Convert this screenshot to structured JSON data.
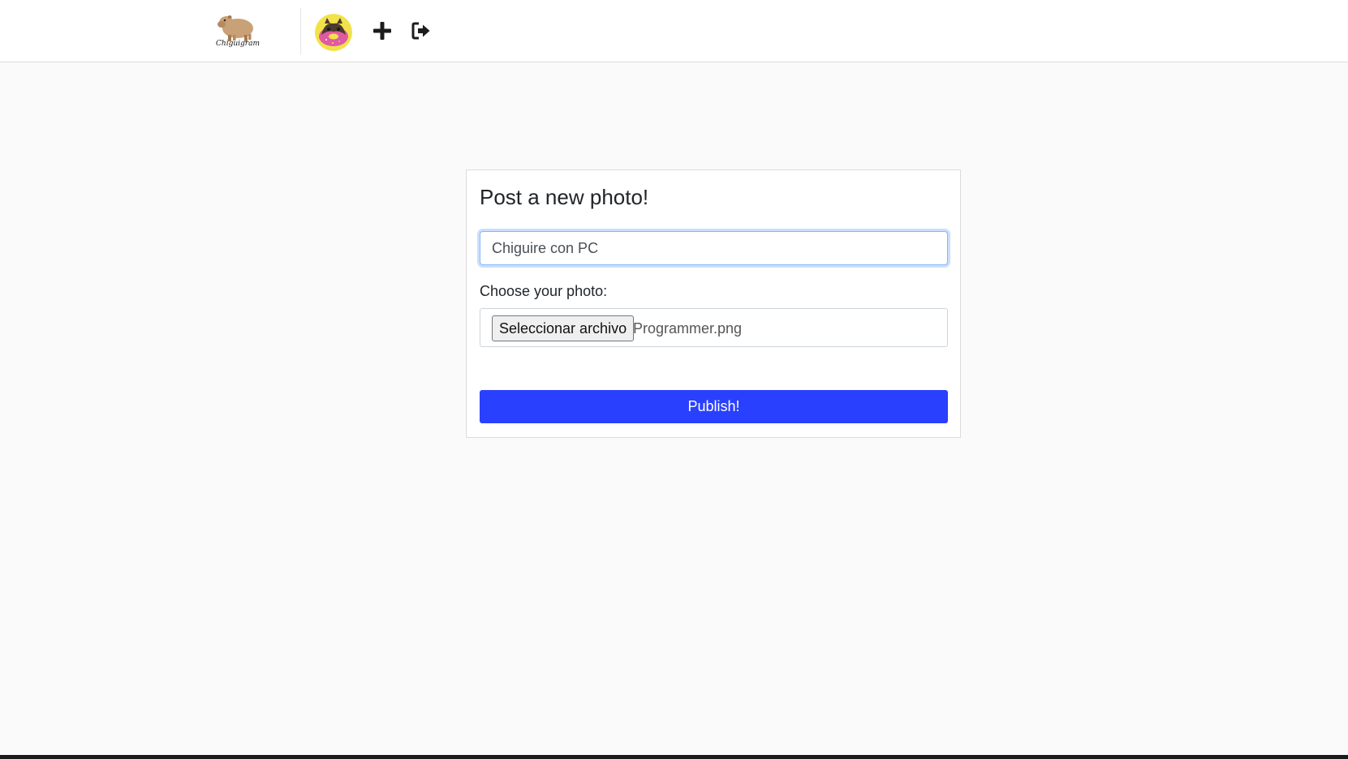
{
  "navbar": {
    "logo_text": "Chiguigram",
    "logo_icon": "capybara-logo",
    "avatar_icon": "user-avatar-donut",
    "plus_icon": "plus-icon",
    "logout_icon": "logout-icon"
  },
  "form": {
    "title": "Post a new photo!",
    "caption_value": "Chiguire con PC",
    "choose_label": "Choose your photo:",
    "file_button_label": "Seleccionar archivo",
    "file_name": "Programmer.png",
    "publish_label": "Publish!"
  },
  "colors": {
    "accent": "#2a40ff",
    "background": "#fafafa",
    "focus_border": "#86b7fe"
  }
}
